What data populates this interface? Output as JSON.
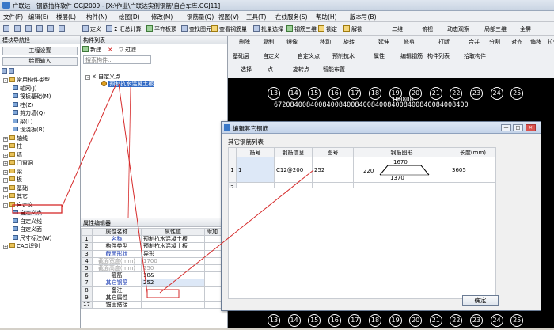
{
  "app": {
    "title": "广联达－钢筋抽样软件 GGJ2009 - [X:\\作业\\广联达实例钢筋\\自合车库.GGJ11]"
  },
  "menu": [
    "文件(F)",
    "编辑(E)",
    "楼层(L)",
    "构件(N)",
    "绘图(D)",
    "修改(M)",
    "钢筋量(Q)",
    "视图(V)",
    "工具(T)",
    "在线服务(S)",
    "帮助(H)",
    "版本号(B)"
  ],
  "toolbar": {
    "items": [
      "定义",
      "Σ 汇总计算",
      "平齐板顶",
      "查找图元",
      "查看钢筋量",
      "批量选择",
      "钢筋三维",
      "锁定",
      "解锁"
    ],
    "right_items": [
      "二维",
      "俯视",
      "动态观察",
      "局部三维",
      "全屏"
    ]
  },
  "left_panel": {
    "title": "模块导航栏",
    "buttons": [
      "工程设置",
      "绘图输入"
    ],
    "tree": [
      {
        "label": "常用构件类型",
        "level": 1,
        "type": "folder",
        "expander": "-"
      },
      {
        "label": "轴网(J)",
        "level": 2,
        "type": "item"
      },
      {
        "label": "筏板基础(M)",
        "level": 2,
        "type": "item"
      },
      {
        "label": "柱(Z)",
        "level": 2,
        "type": "item"
      },
      {
        "label": "剪力墙(Q)",
        "level": 2,
        "type": "item"
      },
      {
        "label": "梁(L)",
        "level": 2,
        "type": "item"
      },
      {
        "label": "现浇板(B)",
        "level": 2,
        "type": "item"
      },
      {
        "label": "轴线",
        "level": 1,
        "type": "folder",
        "expander": "+"
      },
      {
        "label": "柱",
        "level": 1,
        "type": "folder",
        "expander": "+"
      },
      {
        "label": "墙",
        "level": 1,
        "type": "folder",
        "expander": "+"
      },
      {
        "label": "门窗洞",
        "level": 1,
        "type": "folder",
        "expander": "+"
      },
      {
        "label": "梁",
        "level": 1,
        "type": "folder",
        "expander": "+"
      },
      {
        "label": "板",
        "level": 1,
        "type": "folder",
        "expander": "+"
      },
      {
        "label": "基础",
        "level": 1,
        "type": "folder",
        "expander": "+"
      },
      {
        "label": "其它",
        "level": 1,
        "type": "folder",
        "expander": "+"
      },
      {
        "label": "自定义",
        "level": 1,
        "type": "folder",
        "expander": "-"
      },
      {
        "label": "自定义点",
        "level": 2,
        "type": "item",
        "highlight": true
      },
      {
        "label": "自定义线",
        "level": 2,
        "type": "item"
      },
      {
        "label": "自定义面",
        "level": 2,
        "type": "item"
      },
      {
        "label": "尺寸标注(W)",
        "level": 2,
        "type": "item"
      },
      {
        "label": "CAD识别",
        "level": 1,
        "type": "folder",
        "expander": "+"
      }
    ]
  },
  "component_list": {
    "title": "构件列表",
    "new_label": "新建",
    "filter_label": "过滤",
    "search_placeholder": "搜索构件...",
    "root": "自定义点",
    "selected": "预制抗水混凝土板"
  },
  "property_editor": {
    "title": "属性编辑器",
    "headers": [
      "属性名称",
      "属性值",
      "附加"
    ],
    "rows": [
      {
        "n": "1",
        "name": "名称",
        "value": "预制抗水混凝土板",
        "style": "blue"
      },
      {
        "n": "2",
        "name": "构件类型",
        "value": "预制抗水混凝土板",
        "style": "normal"
      },
      {
        "n": "3",
        "name": "截面形状",
        "value": "异形",
        "style": "blue"
      },
      {
        "n": "4",
        "name": "截面宽度(mm)",
        "value": "1700",
        "style": "gray"
      },
      {
        "n": "5",
        "name": "截面高度(mm)",
        "value": "250",
        "style": "gray"
      },
      {
        "n": "6",
        "name": "箍筋",
        "value": "18&",
        "style": "normal"
      },
      {
        "n": "7",
        "name": "其它钢筋",
        "value": "252",
        "style": "blue"
      },
      {
        "n": "8",
        "name": "备注",
        "value": "",
        "style": "normal"
      },
      {
        "n": "9",
        "name": "其它属性",
        "value": "",
        "style": "normal"
      },
      {
        "n": "17",
        "name": "锚固搭接",
        "value": "",
        "style": "normal"
      }
    ]
  },
  "cad": {
    "toolbar_row2": [
      "删除",
      "复制",
      "镜像",
      "移动",
      "旋转",
      "延伸",
      "修剪",
      "打断",
      "合并",
      "分割",
      "对齐",
      "偏移",
      "拉伸"
    ],
    "toolbar_row3": [
      "基础层",
      "自定义",
      "自定义点",
      "预制抗水",
      "属性",
      "编辑钢筋",
      "构件列表",
      "拾取构件"
    ],
    "toolbar_row4": [
      "选择",
      "点",
      "旋转点",
      "智能布置"
    ],
    "axis_top": [
      "13",
      "14",
      "15",
      "16",
      "17",
      "18",
      "19",
      "20",
      "21",
      "22",
      "23",
      "24",
      "25"
    ],
    "axis_bottom": [
      "13",
      "14",
      "15",
      "16",
      "17",
      "18",
      "19",
      "20",
      "21",
      "22",
      "23",
      "24",
      "25"
    ],
    "dim_line": "672084008400840084008400840084008400840084008400",
    "dim_total": "100800"
  },
  "dialog": {
    "title": "编辑其它钢筋",
    "section": "其它钢筋列表",
    "headers": [
      "筋号",
      "钢筋信息",
      "图号",
      "钢筋图形",
      "长度(mm)"
    ],
    "rows": [
      {
        "n": "1",
        "bar": "1",
        "info": "C12@200",
        "fig": "252",
        "shape_left": "220",
        "shape_top": "1670",
        "shape_bottom": "1370",
        "length": "3605"
      },
      {
        "n": "2",
        "bar": "",
        "info": "",
        "fig": "",
        "shape_left": "",
        "shape_top": "",
        "shape_bottom": "",
        "length": ""
      }
    ],
    "ok_label": "确定"
  },
  "colors": {
    "accent_red": "#d62a2a",
    "selection": "#316ac5",
    "cad_bg": "#000000"
  }
}
